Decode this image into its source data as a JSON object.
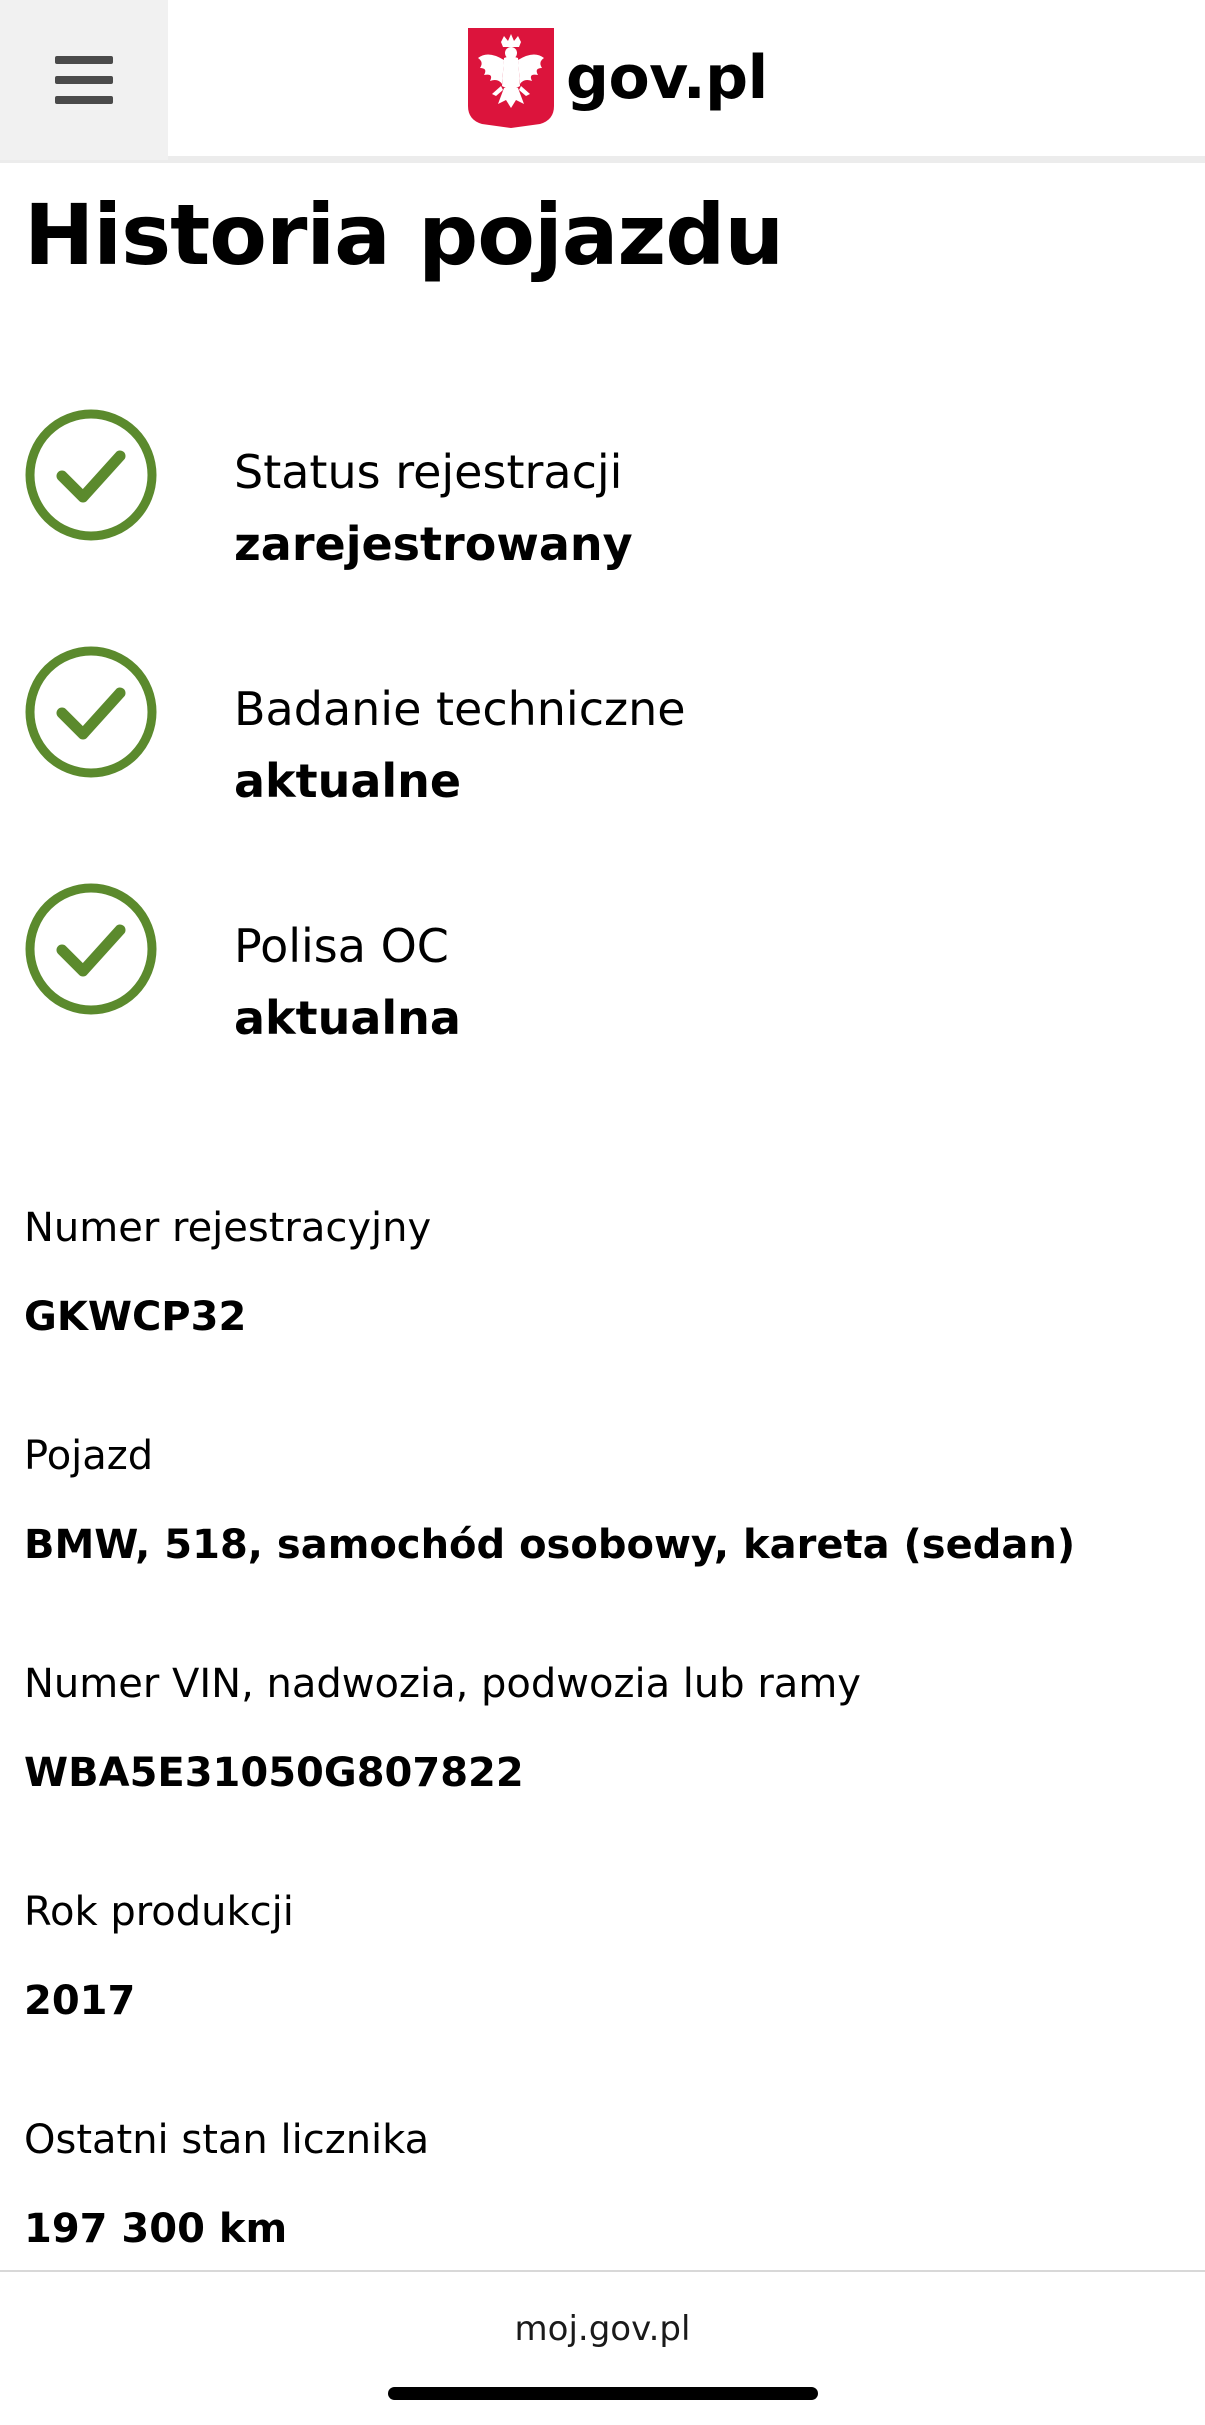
{
  "header": {
    "menu_icon": "hamburger-icon",
    "logo_icon": "polish-eagle-emblem-icon",
    "logo_text": "gov.pl",
    "brand_color": "#dc143c"
  },
  "page": {
    "title": "Historia pojazdu"
  },
  "statuses": [
    {
      "label": "Status rejestracji",
      "value": "zarejestrowany",
      "icon": "check-circle-icon"
    },
    {
      "label": "Badanie techniczne",
      "value": "aktualne",
      "icon": "check-circle-icon"
    },
    {
      "label": "Polisa OC",
      "value": "aktualna",
      "icon": "check-circle-icon"
    }
  ],
  "status_color": "#5b8a2d",
  "fields": [
    {
      "label": "Numer rejestracyjny",
      "value": "GKWCP32"
    },
    {
      "label": "Pojazd",
      "value": "BMW, 518, samochód osobowy, kareta (sedan)"
    },
    {
      "label": "Numer VIN, nadwozia, podwozia lub ramy",
      "value": "WBA5E31050G807822"
    },
    {
      "label": "Rok produkcji",
      "value": "2017"
    },
    {
      "label": "Ostatni stan licznika",
      "value": "197 300 km"
    }
  ],
  "footer": {
    "link": "moj.gov.pl"
  }
}
